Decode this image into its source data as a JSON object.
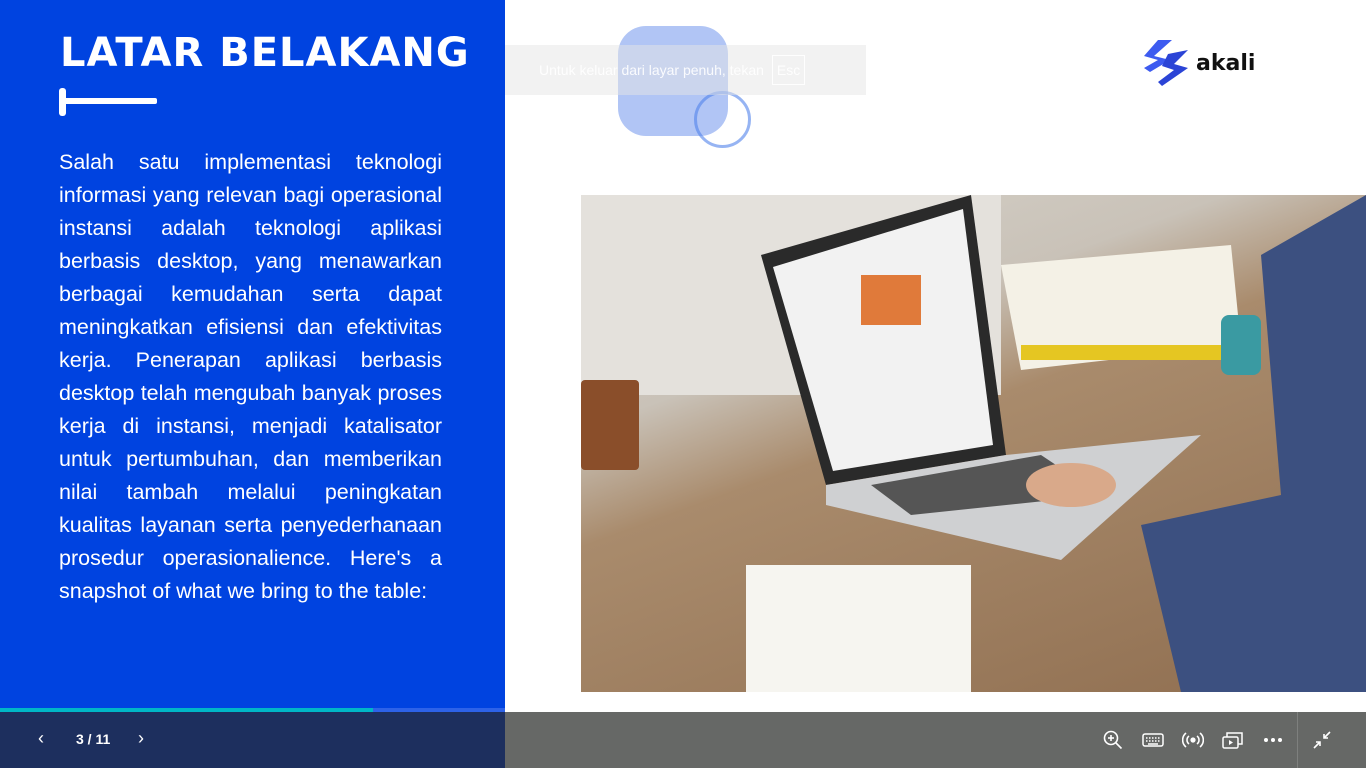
{
  "slide": {
    "title": "LATAR BELAKANG",
    "body": "Salah satu implementasi teknologi informasi yang relevan bagi operasional instansi adalah teknologi aplikasi berbasis desktop, yang menawarkan berbagai kemudahan serta dapat meningkatkan efisiensi dan efektivitas kerja. Penerapan aplikasi berbasis desktop telah mengubah banyak proses kerja di instansi, menjadi katalisator untuk pertumbuhan, dan memberikan nilai tambah melalui peningkatan kualitas layanan serta penyederhanaan prosedur operasionalience. Here's a snapshot of what we bring to the table:",
    "logo_text": "akali",
    "accent_color": "#0043e0"
  },
  "fullscreen_toast": {
    "message": "Untuk keluar dari layar penuh, tekan",
    "key": "Esc"
  },
  "player": {
    "current_page": 3,
    "total_pages": 11,
    "counter": "3 / 11",
    "progress_percent": 27.3,
    "tools": [
      "zoom-in-icon",
      "keyboard-icon",
      "broadcast-icon",
      "slideshow-icon",
      "more-icon",
      "exit-fullscreen-icon"
    ]
  }
}
